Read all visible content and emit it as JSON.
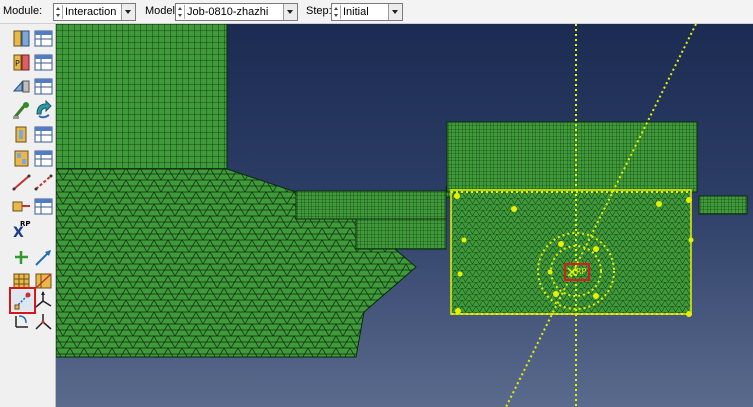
{
  "context_bar": {
    "module": {
      "label": "Module:",
      "value": "Interaction"
    },
    "model": {
      "label": "Model:",
      "value": "Job-0810-zhazhi"
    },
    "step": {
      "label": "Step:",
      "value": "Initial"
    }
  },
  "toolbox": {
    "rp_text": "RP",
    "selected_tool": "create-constraint-tool"
  },
  "viewport": {
    "rp_label": "RP",
    "colors": {
      "mesh_fill": "#3f9a3a",
      "mesh_edge": "#0c2a0c",
      "highlight": "#e8f000",
      "selection_box": "#e01818"
    }
  }
}
